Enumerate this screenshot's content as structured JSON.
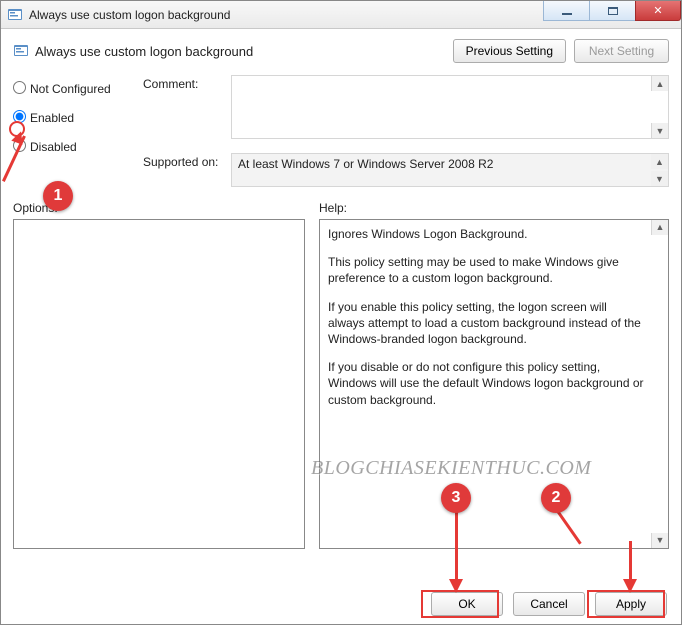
{
  "window": {
    "title": "Always use custom logon background"
  },
  "header": {
    "policy_title": "Always use custom logon background",
    "prev_btn": "Previous Setting",
    "next_btn": "Next Setting"
  },
  "radios": {
    "not_configured": "Not Configured",
    "enabled": "Enabled",
    "disabled": "Disabled",
    "selected": "enabled"
  },
  "fields": {
    "comment_label": "Comment:",
    "comment_value": "",
    "supported_label": "Supported on:",
    "supported_value": "At least Windows 7 or Windows Server 2008 R2"
  },
  "labels": {
    "options": "Options:",
    "help": "Help:"
  },
  "help_text": {
    "p1": "Ignores Windows Logon Background.",
    "p2": "This policy setting may be used to make Windows give preference to a custom logon background.",
    "p3": "If you enable this policy setting, the logon screen will always attempt to load a custom background instead of the Windows-branded logon background.",
    "p4": "If you disable or do not configure this policy setting, Windows will use the default Windows logon background or custom background."
  },
  "footer": {
    "ok": "OK",
    "cancel": "Cancel",
    "apply": "Apply"
  },
  "annotations": {
    "num1": "1",
    "num2": "2",
    "num3": "3",
    "watermark": "BLOGCHIASEKIENTHUC.COM"
  }
}
